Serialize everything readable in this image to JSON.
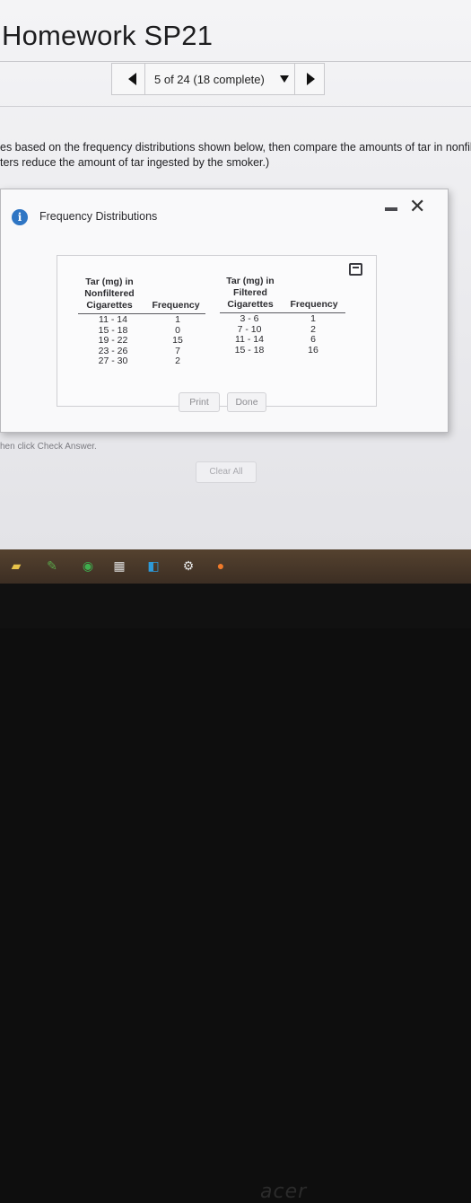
{
  "header": {
    "title": "Homework SP21"
  },
  "nav": {
    "position_label": "5 of 24 (18 complete)"
  },
  "question": {
    "line1": "es based on the frequency distributions shown below, then compare the amounts of tar in nonfilte",
    "line2": "ters reduce the amount of tar ingested by the smoker.)"
  },
  "dialog": {
    "title": "Frequency Distributions",
    "icon": "info-icon",
    "nonfiltered": {
      "header": [
        "Tar (mg) in",
        "Nonfiltered",
        "Cigarettes"
      ],
      "freq_header": "Frequency",
      "classes": [
        "11 - 14",
        "15 - 18",
        "19 - 22",
        "23 - 26",
        "27 - 30"
      ],
      "frequencies": [
        "1",
        "0",
        "15",
        "7",
        "2"
      ]
    },
    "filtered": {
      "header": [
        "Tar (mg) in",
        "Filtered",
        "Cigarettes"
      ],
      "freq_header": "Frequency",
      "classes": [
        "3 - 6",
        "7 - 10",
        "11 - 14",
        "15 - 18"
      ],
      "frequencies": [
        "1",
        "2",
        "6",
        "16"
      ]
    },
    "print_label": "Print",
    "done_label": "Done"
  },
  "footer": {
    "hint": "hen click Check Answer.",
    "clear_all_label": "Clear All"
  },
  "taskbar": {
    "icons": [
      "chrome-icon",
      "store-icon",
      "app-icon",
      "settings-icon",
      "firefox-icon"
    ]
  },
  "brand": "acer",
  "colors": {
    "info_blue": "#2f76c4",
    "panel_border": "#cfcfd3"
  }
}
